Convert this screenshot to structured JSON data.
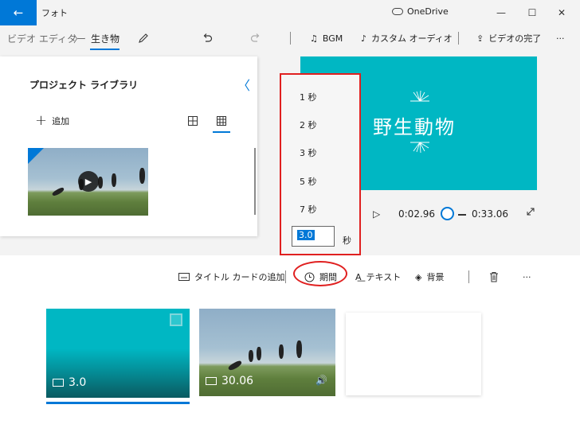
{
  "titlebar": {
    "back_icon": "←",
    "app_title": "フォト",
    "onedrive_label": "OneDrive",
    "minimize": "—",
    "maximize": "☐",
    "close": "✕"
  },
  "toolbar": {
    "breadcrumb_parent": "ビデオ エディター",
    "breadcrumb_separator": "〉",
    "project_name": "生き物",
    "bgm_label": "BGM",
    "custom_audio_label": "カスタム オーディオ",
    "finish_video_label": "ビデオの完了",
    "more": "···"
  },
  "library": {
    "title": "プロジェクト ライブラリ",
    "collapse_icon": "〈",
    "add_label": "追加",
    "add_icon": "+"
  },
  "preview": {
    "title": "野生動物",
    "current_time": "0:02.96",
    "total_time": "0:33.06",
    "play_icon": "▷"
  },
  "duration_flyout": {
    "options": [
      "1 秒",
      "2 秒",
      "3 秒",
      "5 秒",
      "7 秒"
    ],
    "custom_value": "3.0",
    "unit": "秒"
  },
  "storyboard_toolbar": {
    "add_title_card_label": "タイトル カードの追加",
    "duration_label": "期間",
    "text_label": "テキスト",
    "background_label": "背景",
    "more": "···"
  },
  "storyboard": {
    "title_card_duration": "3.0",
    "video_clip_duration": "30.06",
    "audio_icon": "🔊"
  },
  "colors": {
    "accent": "#0078d7",
    "teal": "#00b7c3",
    "highlight_red": "#e02020"
  }
}
